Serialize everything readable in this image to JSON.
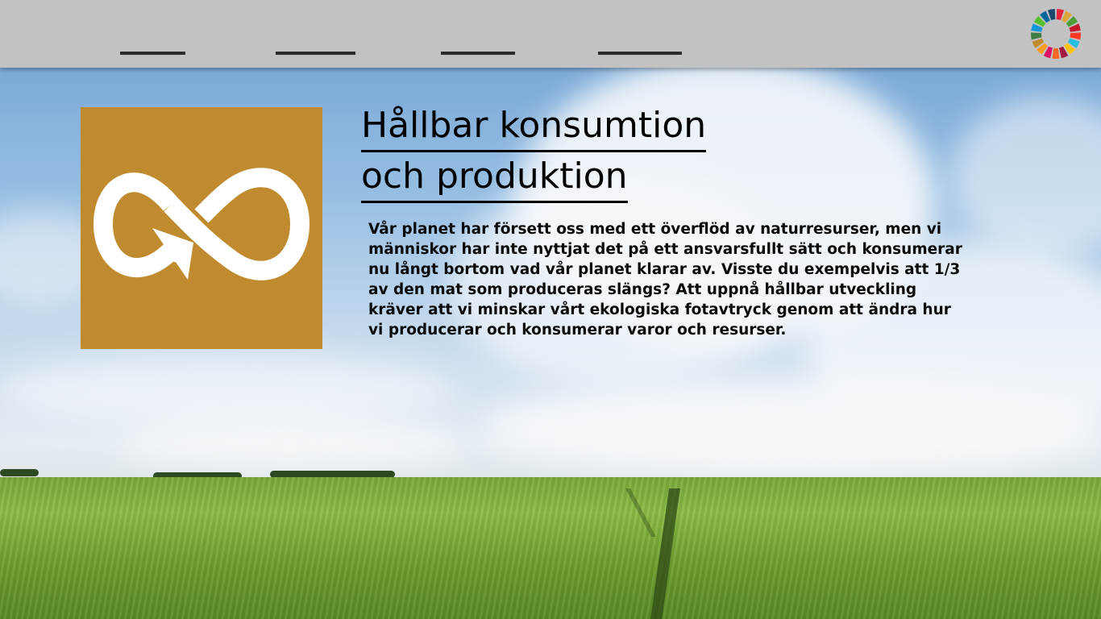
{
  "nav": {
    "links": [
      {
        "label": ""
      },
      {
        "label": ""
      },
      {
        "label": ""
      },
      {
        "label": ""
      }
    ]
  },
  "sdg_logo": {
    "icon": "sdg-color-wheel-icon",
    "colors": [
      "#e5243b",
      "#dda63a",
      "#4c9f38",
      "#c5192d",
      "#ff3a21",
      "#26bde2",
      "#fcc30b",
      "#a21942",
      "#fd6925",
      "#dd1367",
      "#fd9d24",
      "#bf8b2e",
      "#3f7e44",
      "#0a97d9",
      "#56c02b",
      "#00689d",
      "#19486a"
    ]
  },
  "goal": {
    "icon": "infinity-arrow-icon",
    "color": "#bf8b2e",
    "title_line1": "Hållbar konsumtion ",
    "title_line2": "och produktion",
    "body": "Vår planet har försett oss med ett överflöd av naturresurser, men vi människor har inte nyttjat det på ett ansvarsfullt sätt och konsumerar nu långt bortom vad vår planet klarar av. Visste du exempelvis att 1/3 av den mat som produceras slängs? Att uppnå hållbar utveckling kräver att vi minskar vårt ekologiska fotavtryck genom att ändra hur vi producerar och konsumerar varor och resurser."
  }
}
